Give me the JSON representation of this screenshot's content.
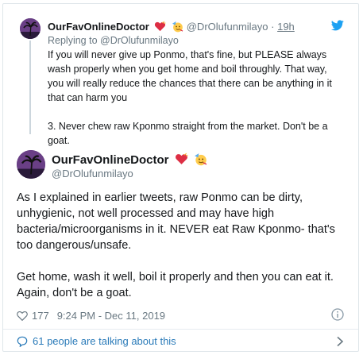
{
  "parent_tweet": {
    "display_name": "OurFavOnlineDoctor",
    "handle": "@DrOlufunmilayo",
    "time": "19h",
    "replying_to": "Replying to @DrOlufunmilayo",
    "paragraphs": [
      "If you will never give up Ponmo, that's fine, but PLEASE always wash properly when you get home and boil throughly. That way, you will really reduce the chances that there can be anything in it that can harm you",
      "3. Never chew raw Kponmo straight from the market. Don't be a goat."
    ]
  },
  "main_tweet": {
    "display_name": "OurFavOnlineDoctor",
    "handle": "@DrOlufunmilayo",
    "paragraphs": [
      "As I explained in earlier tweets, raw Ponmo can be dirty, unhygienic, not well processed and may have high bacteria/microorganisms in it. NEVER eat Raw Kponmo- that's too dangerous/unsafe.",
      "Get home, wash it well, boil it properly and then you can eat it. Again, don't be a goat."
    ],
    "like_count": "177",
    "timestamp": "9:24 PM - Dec 11, 2019"
  },
  "footer": {
    "talking_label": "61 people are talking about this"
  },
  "icons": {
    "bird": "twitter-bird-icon",
    "heart": "heart-icon",
    "info": "info-icon",
    "chat": "chat-bubble-icon",
    "chevron": "chevron-right-icon"
  },
  "colors": {
    "twitter_blue": "#1da1f2",
    "link_blue": "#2b7bb9",
    "secondary_text": "#697882"
  }
}
